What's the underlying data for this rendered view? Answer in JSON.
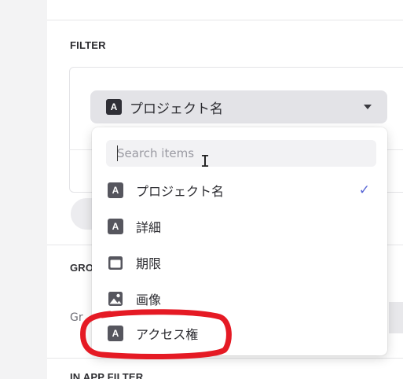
{
  "sections": {
    "filter_label": "FILTER",
    "grouping_label": "GRO",
    "group_label_2": "Gr",
    "bottom_label": "IN APP FILTER"
  },
  "filter": {
    "selected_field": "プロジェクト名",
    "selected_type_glyph": "A"
  },
  "dropdown": {
    "search_placeholder": "Search items",
    "options": [
      {
        "label": "プロジェクト名",
        "type": "text",
        "glyph": "A",
        "selected": true
      },
      {
        "label": "詳細",
        "type": "text",
        "glyph": "A",
        "selected": false
      },
      {
        "label": "期限",
        "type": "date",
        "icon": "calendar-icon",
        "selected": false
      },
      {
        "label": "画像",
        "type": "image",
        "icon": "image-icon",
        "selected": false
      },
      {
        "label": "アクセス権",
        "type": "text",
        "glyph": "A",
        "selected": false
      }
    ],
    "check_glyph": "✓"
  },
  "colors": {
    "accent_check": "#5866d6",
    "annotation_red": "#e51a24",
    "field_bg": "#e3e3e7"
  }
}
